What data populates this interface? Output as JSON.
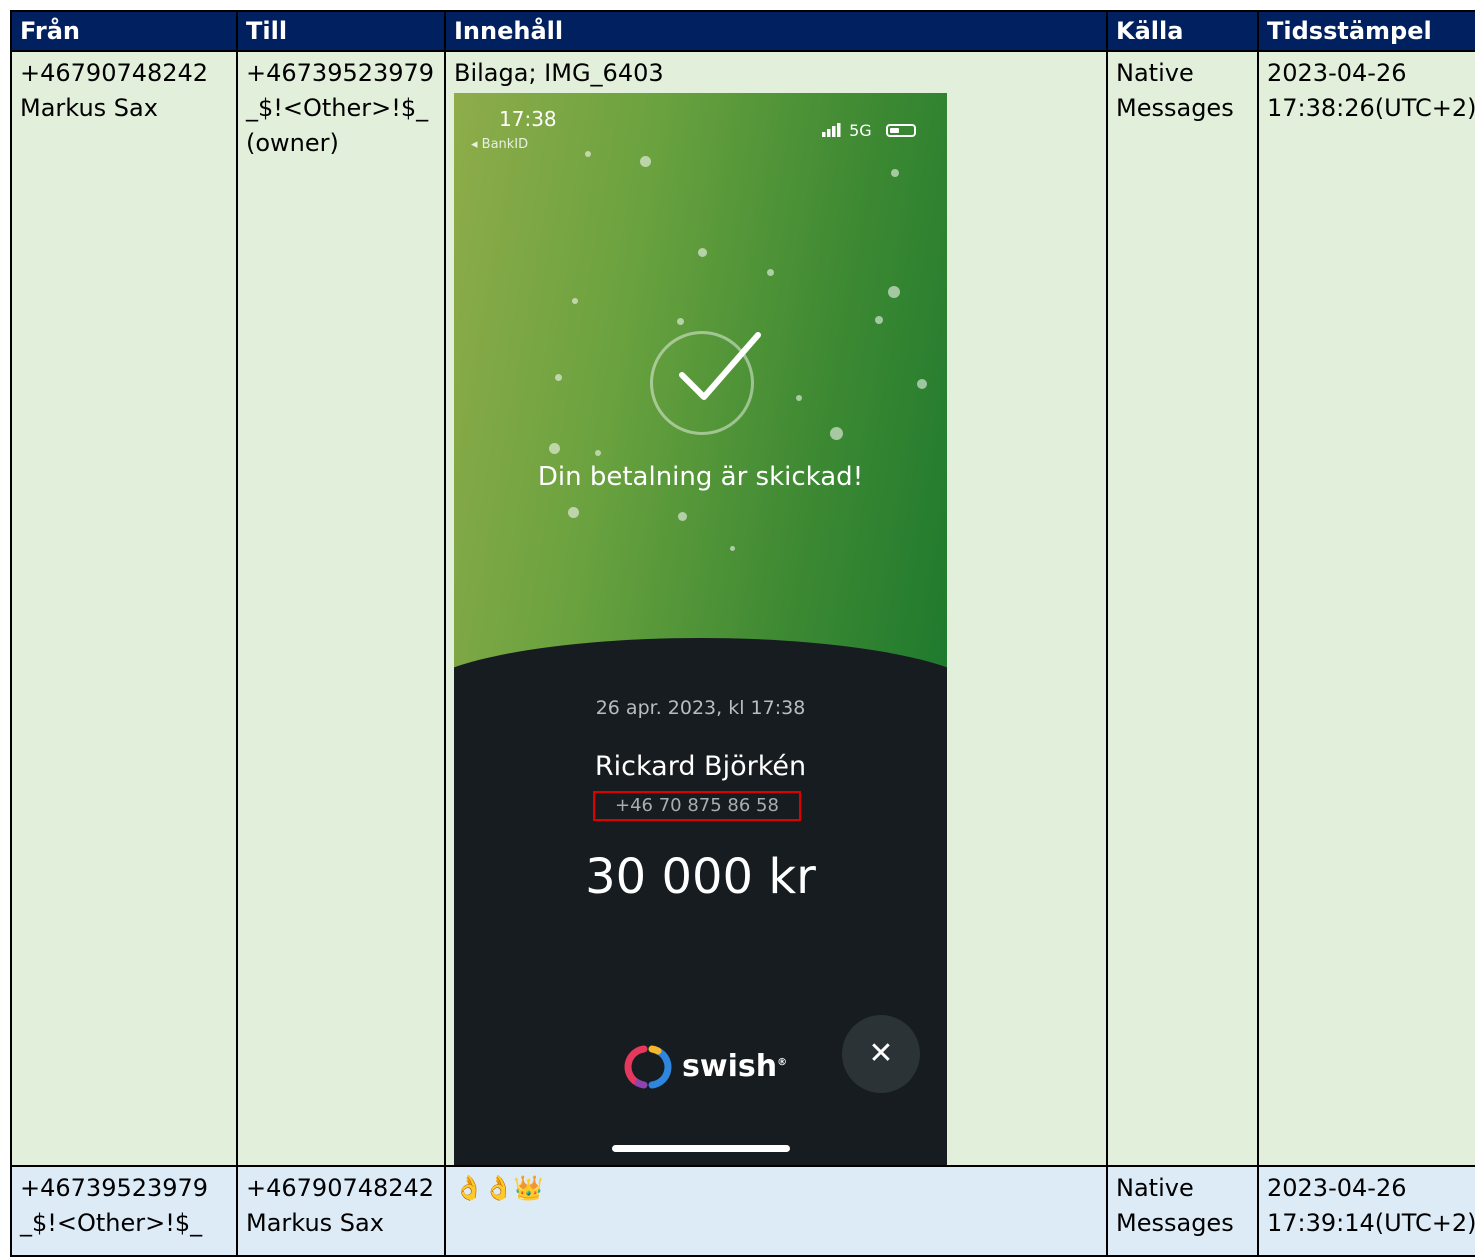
{
  "headers": [
    "Från",
    "Till",
    "Innehåll",
    "Källa",
    "Tidsstämpel"
  ],
  "rows": [
    {
      "from": "+46790748242\nMarkus Sax",
      "to": "+46739523979\n_$!<Other>!$_\n(owner)",
      "content_label": "Bilaga; IMG_6403",
      "source": "Native\nMessages",
      "timestamp": "2023-04-26\n17:38:26(UTC+2)",
      "attachment": {
        "status_time": "17:38",
        "back_label": "◂ BankID",
        "network": "5G",
        "confirmation": "Din betalning är skickad!",
        "date": "26 apr. 2023, kl 17:38",
        "payee_name": "Rickard Björkén",
        "payee_phone": "+46 70 875 86 58",
        "amount": "30 000 kr",
        "brand": "swish",
        "close_icon": "close-icon",
        "highlight_color": "#e00000"
      }
    },
    {
      "from": "+46739523979\n_$!<Other>!$_",
      "to": "+46790748242\nMarkus Sax",
      "content": "👌👌👑",
      "source": "Native\nMessages",
      "timestamp": "2023-04-26\n17:39:14(UTC+2)"
    }
  ],
  "colors": {
    "header_bg": "#002060",
    "row1_bg": "#e2efda",
    "row2_bg": "#ddebf7"
  }
}
